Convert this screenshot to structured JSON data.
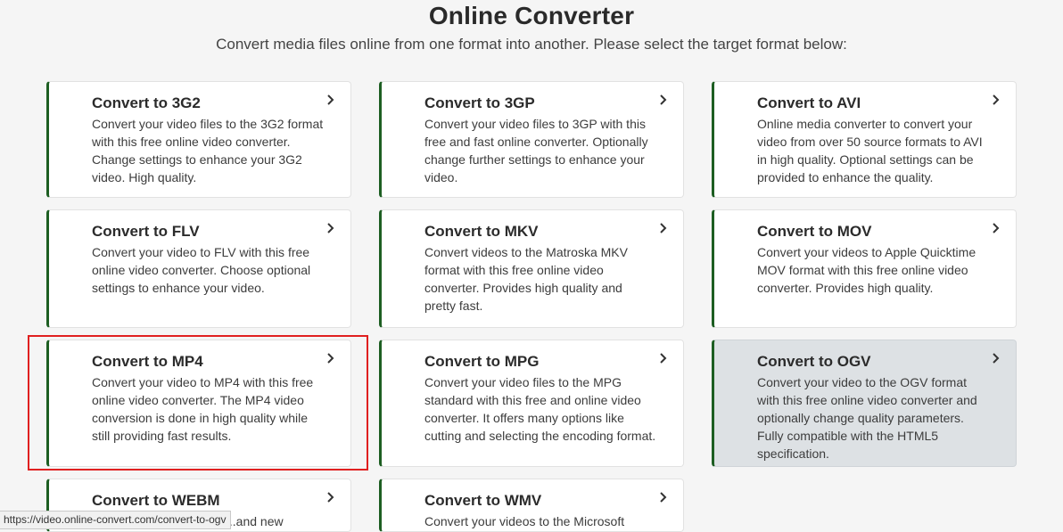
{
  "header": {
    "title": "Online Converter",
    "subtitle": "Convert media files online from one format into another. Please select the target format below:"
  },
  "cards": [
    {
      "title": "Convert to 3G2",
      "desc": "Convert your video files to the 3G2 format with this free online video converter. Change settings to enhance your 3G2 video. High quality."
    },
    {
      "title": "Convert to 3GP",
      "desc": "Convert your video files to 3GP with this free and fast online converter. Optionally change further settings to enhance your video."
    },
    {
      "title": "Convert to AVI",
      "desc": "Online media converter to convert your video from over 50 source formats to AVI in high quality. Optional settings can be provided to enhance the quality."
    },
    {
      "title": "Convert to FLV",
      "desc": "Convert your video to FLV with this free online video converter. Choose optional settings to enhance your video."
    },
    {
      "title": "Convert to MKV",
      "desc": "Convert videos to the Matroska MKV format with this free online video converter. Provides high quality and pretty fast."
    },
    {
      "title": "Convert to MOV",
      "desc": "Convert your videos to Apple Quicktime MOV format with this free online video converter. Provides high quality."
    },
    {
      "title": "Convert to MP4",
      "desc": "Convert your video to MP4 with this free online video converter. The MP4 video conversion is done in high quality while still providing fast results."
    },
    {
      "title": "Convert to MPG",
      "desc": "Convert your video files to the MPG standard with this free and online video converter. It offers many options like cutting and selecting the encoding format."
    },
    {
      "title": "Convert to OGV",
      "desc": "Convert your video to the OGV format with this free online video converter and optionally change quality parameters. Fully compatible with the HTML5 specification."
    },
    {
      "title": "Convert to WEBM",
      "desc": "...and new WEBM"
    },
    {
      "title": "Convert to WMV",
      "desc": "Convert your videos to the Microsoft"
    }
  ],
  "icons": {
    "card_arrow": "chevron-right-icon"
  },
  "colors": {
    "accent": "#1d5e22",
    "hover_card": "#dde1e4",
    "highlight": "#e02020"
  },
  "status_bar": {
    "url": "https://video.online-convert.com/convert-to-ogv"
  }
}
